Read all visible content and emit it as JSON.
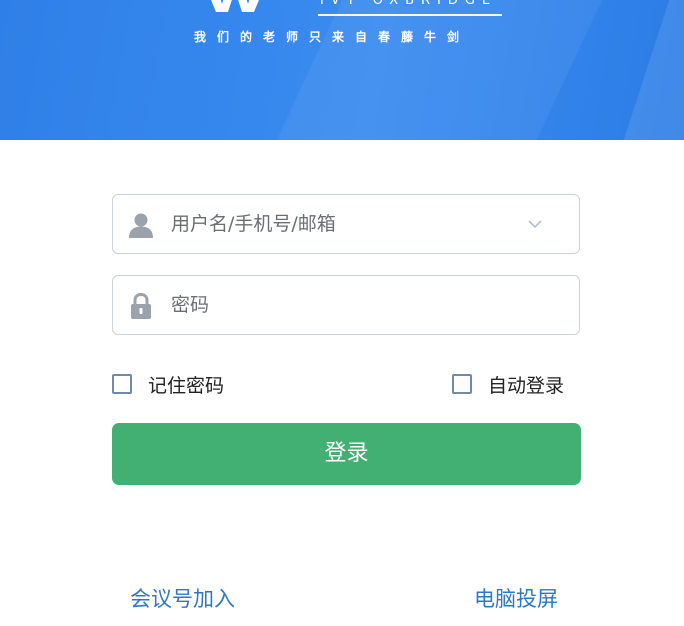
{
  "header": {
    "brand_en": "IVY OXBRIDGE",
    "slogan": "我们的老师只来自春藤牛剑"
  },
  "form": {
    "username": {
      "placeholder": "用户名/手机号/邮箱",
      "icon": "user-icon"
    },
    "password": {
      "placeholder": "密码",
      "icon": "lock-icon"
    },
    "remember_label": "记住密码",
    "auto_login_label": "自动登录",
    "login_label": "登录"
  },
  "footer": {
    "join_meeting": "会议号加入",
    "screen_cast": "电脑投屏"
  },
  "colors": {
    "banner": "#3388ee",
    "login_button": "#43b073",
    "link": "#2f78c4",
    "border": "#c9d2dc"
  }
}
